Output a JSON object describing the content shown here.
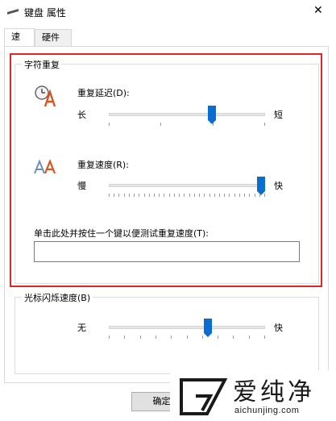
{
  "window": {
    "title": "键盘 属性"
  },
  "tabs": [
    {
      "label": "速度",
      "active": true
    },
    {
      "label": "硬件",
      "active": false
    }
  ],
  "repeat_group": {
    "legend": "字符重复",
    "delay": {
      "label": "重复延迟(D):",
      "min_label": "长",
      "max_label": "短",
      "value_fraction": 0.67,
      "tick_count": 4
    },
    "rate": {
      "label": "重复速度(R):",
      "min_label": "慢",
      "max_label": "快",
      "value_fraction": 1.0,
      "tick_count": 32
    },
    "test": {
      "label": "单击此处并按住一个键以便测试重复速度(T):",
      "value": ""
    }
  },
  "cursor_group": {
    "legend": "光标闪烁速度(B)",
    "blink": {
      "min_label": "无",
      "max_label": "快",
      "value_fraction": 0.64,
      "tick_count": 11
    }
  },
  "buttons": {
    "ok": "确定"
  },
  "watermark": {
    "cn": "爱纯净",
    "url": "aichunjing.com"
  },
  "colors": {
    "accent": "#0a6ed1",
    "highlight": "#e0262b"
  }
}
